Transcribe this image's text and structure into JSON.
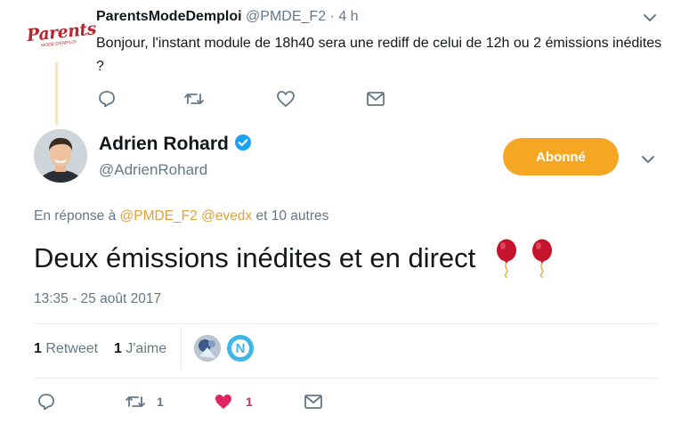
{
  "parent_tweet": {
    "author_name": "ParentsModeDemploi",
    "author_handle": "@PMDE_F2",
    "time": "· 4 h",
    "text": "Bonjour, l'instant module de 18h40 sera une rediff de celui de 12h ou 2 émissions inédites ?",
    "avatar_logo_text": "Parents",
    "avatar_logo_subtext": "MODE D'EMPLOI"
  },
  "main_tweet": {
    "author_name": "Adrien Rohard",
    "author_handle": "@AdrienRohard",
    "follow_button_label": "Abonné",
    "reply_prefix": "En réponse à",
    "reply_mention_1": "@PMDE_F2",
    "reply_mention_2": "@evedx",
    "reply_suffix": "et 10 autres",
    "text": "Deux émissions inédites et en direct",
    "emoji": "🎈🎈",
    "timestamp": "13:35 - 25 août 2017",
    "stats": {
      "retweet_count": "1",
      "retweet_label": "Retweet",
      "like_count": "1",
      "like_label": "J'aime"
    },
    "actions": {
      "retweet_count": "1",
      "like_count": "1"
    }
  },
  "colors": {
    "accent": "#f5a623",
    "verified": "#1da1f2",
    "like": "#e0245e",
    "muted": "#657786"
  }
}
